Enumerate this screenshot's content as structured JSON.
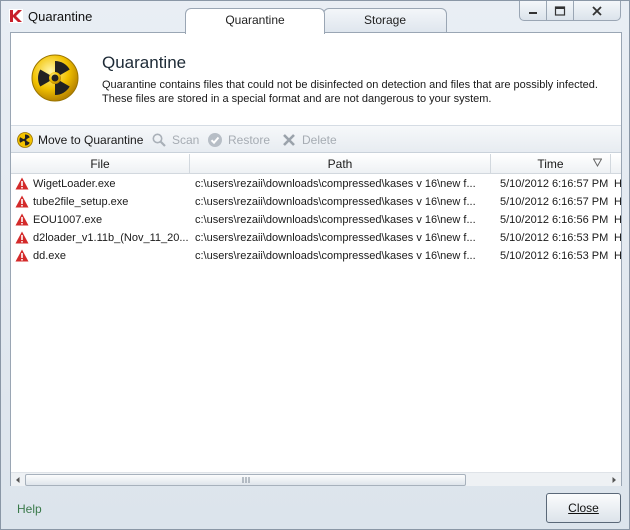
{
  "window": {
    "title": "Quarantine",
    "tabs": [
      {
        "label": "Quarantine",
        "active": true
      },
      {
        "label": "Storage",
        "active": false
      }
    ]
  },
  "header": {
    "title": "Quarantine",
    "description": "Quarantine contains files that could not be disinfected on detection and files that are possibly infected. These files are stored in a special format and are not dangerous to your system.",
    "icon": "radiation-hazard-icon"
  },
  "toolbar": {
    "move": "Move to Quarantine",
    "scan": "Scan",
    "restore": "Restore",
    "delete": "Delete"
  },
  "table": {
    "columns": [
      "File",
      "Path",
      "Time"
    ],
    "rows": [
      {
        "file": "WigetLoader.exe",
        "path": "c:\\users\\rezaii\\downloads\\compressed\\kases v 16\\new f...",
        "time": "5/10/2012 6:16:57 PM",
        "extra": "H"
      },
      {
        "file": "tube2file_setup.exe",
        "path": "c:\\users\\rezaii\\downloads\\compressed\\kases v 16\\new f...",
        "time": "5/10/2012 6:16:57 PM",
        "extra": "H"
      },
      {
        "file": "EOU1007.exe",
        "path": "c:\\users\\rezaii\\downloads\\compressed\\kases v 16\\new f...",
        "time": "5/10/2012 6:16:56 PM",
        "extra": "H"
      },
      {
        "file": "d2loader_v1.11b_(Nov_11_20...",
        "path": "c:\\users\\rezaii\\downloads\\compressed\\kases v 16\\new f...",
        "time": "5/10/2012 6:16:53 PM",
        "extra": "H"
      },
      {
        "file": "dd.exe",
        "path": "c:\\users\\rezaii\\downloads\\compressed\\kases v 16\\new f...",
        "time": "5/10/2012 6:16:53 PM",
        "extra": "H"
      }
    ]
  },
  "footer": {
    "help": "Help",
    "close": "Close"
  },
  "colors": {
    "accent_red": "#c8202a",
    "help_green": "#3a7a4a",
    "hazard_yellow": "#f2c200"
  }
}
